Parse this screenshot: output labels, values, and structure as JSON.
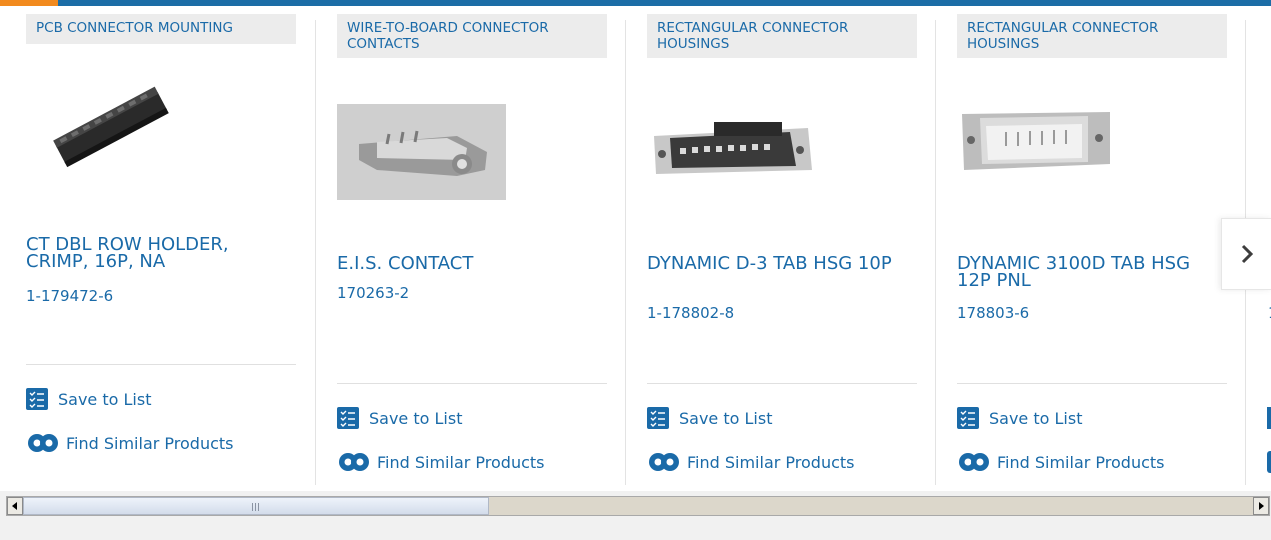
{
  "cards": [
    {
      "category": "PCB CONNECTOR MOUNTING",
      "title": "CT DBL ROW HOLDER, CRIMP, 16P, NA",
      "part_number": "1-179472-6",
      "save_label": "Save to List",
      "similar_label": "Find Similar Products",
      "image_icon": "crimp-holder-product-image"
    },
    {
      "category": "WIRE-TO-BOARD CONNECTOR CONTACTS",
      "title": "E.I.S. CONTACT",
      "part_number": "170263-2",
      "save_label": "Save to List",
      "similar_label": "Find Similar Products",
      "image_icon": "crimp-contact-product-image"
    },
    {
      "category": "RECTANGULAR CONNECTOR HOUSINGS",
      "title": "DYNAMIC D-3 TAB HSG 10P",
      "part_number": "1-178802-8",
      "save_label": "Save to List",
      "similar_label": "Find Similar Products",
      "image_icon": "tab-housing-product-image"
    },
    {
      "category": "RECTANGULAR CONNECTOR HOUSINGS",
      "title": "DYNAMIC 3100D TAB HSG 12P PNL",
      "part_number": "178803-6",
      "save_label": "Save to List",
      "similar_label": "Find Similar Products",
      "image_icon": "panel-housing-product-image"
    }
  ],
  "partial_card": {
    "part_number_fragment": "1"
  },
  "next_icon": "chevron-right-icon",
  "colors": {
    "accent": "#1a6aa8",
    "topbar": "#1c6da6",
    "topbar_accent": "#f28a1e",
    "category_bg": "#ececec"
  }
}
